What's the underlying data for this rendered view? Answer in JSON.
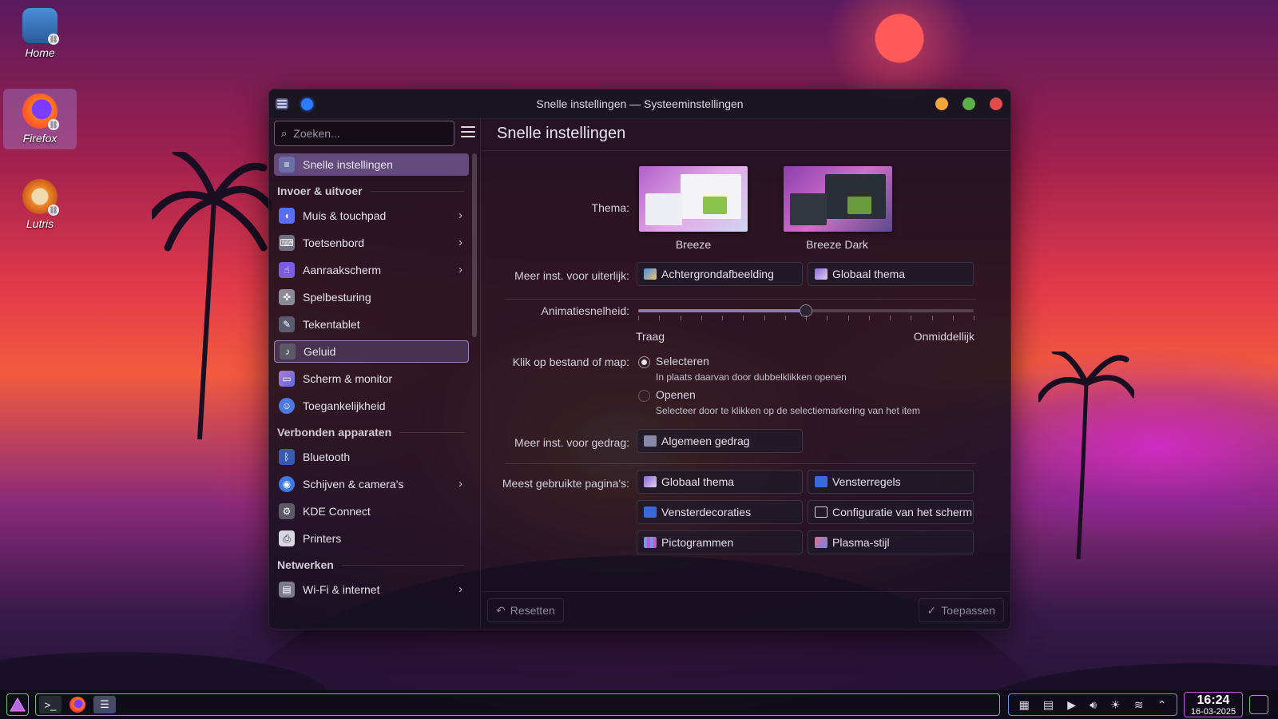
{
  "desktop": {
    "icons": [
      {
        "label": "Home",
        "icon": "folder-icon"
      },
      {
        "label": "Firefox",
        "icon": "firefox-icon"
      },
      {
        "label": "Lutris",
        "icon": "lutris-icon"
      }
    ]
  },
  "window": {
    "title": "Snelle instellingen — Systeeminstellingen"
  },
  "sidebar": {
    "search_placeholder": "Zoeken...",
    "top_item": "Snelle instellingen",
    "sections": [
      {
        "title": "Invoer & uitvoer",
        "items": [
          {
            "label": "Muis & touchpad",
            "icon": "mouse-icon",
            "chevron": true
          },
          {
            "label": "Toetsenbord",
            "icon": "keyboard-icon",
            "chevron": true
          },
          {
            "label": "Aanraakscherm",
            "icon": "touchscreen-icon",
            "chevron": true
          },
          {
            "label": "Spelbesturing",
            "icon": "gamepad-icon",
            "chevron": false
          },
          {
            "label": "Tekentablet",
            "icon": "tablet-icon",
            "chevron": false
          },
          {
            "label": "Geluid",
            "icon": "sound-icon",
            "chevron": false
          },
          {
            "label": "Scherm & monitor",
            "icon": "display-icon",
            "chevron": false
          },
          {
            "label": "Toegankelijkheid",
            "icon": "accessibility-icon",
            "chevron": false
          }
        ]
      },
      {
        "title": "Verbonden apparaten",
        "items": [
          {
            "label": "Bluetooth",
            "icon": "bluetooth-icon",
            "chevron": false
          },
          {
            "label": "Schijven & camera's",
            "icon": "drive-icon",
            "chevron": true
          },
          {
            "label": "KDE Connect",
            "icon": "kdeconnect-icon",
            "chevron": false
          },
          {
            "label": "Printers",
            "icon": "printer-icon",
            "chevron": false
          }
        ]
      },
      {
        "title": "Netwerken",
        "items": [
          {
            "label": "Wi-Fi & internet",
            "icon": "wifi-icon",
            "chevron": true
          }
        ]
      }
    ]
  },
  "content": {
    "title": "Snelle instellingen",
    "theme_label": "Thema:",
    "themes": [
      {
        "name": "Breeze"
      },
      {
        "name": "Breeze Dark"
      }
    ],
    "appearance_label": "Meer inst. voor uiterlijk:",
    "appearance_buttons": [
      "Achtergrondafbeelding",
      "Globaal thema"
    ],
    "animation_label": "Animatiesnelheid:",
    "animation_value": 0.5,
    "animation_min": "Traag",
    "animation_max": "Onmiddellijk",
    "click_label": "Klik op bestand of map:",
    "click_options": [
      {
        "label": "Selecteren",
        "hint": "In plaats daarvan door dubbelklikken openen",
        "selected": true
      },
      {
        "label": "Openen",
        "hint": "Selecteer door te klikken op de selectiemarkering van het item",
        "selected": false
      }
    ],
    "behavior_label": "Meer inst. voor gedrag:",
    "behavior_button": "Algemeen gedrag",
    "most_used_label": "Meest gebruikte pagina's:",
    "most_used": [
      "Globaal thema",
      "Vensterregels",
      "Vensterdecoraties",
      "Configuratie van het scherm",
      "Pictogrammen",
      "Plasma-stijl"
    ],
    "reset_label": "Resetten",
    "apply_label": "Toepassen"
  },
  "taskbar": {
    "time": "16:24",
    "date": "16-03-2025"
  },
  "colors": {
    "accent": "#9a82d0",
    "close": "#e24b4b",
    "minimize": "#f0a63a",
    "maximize": "#5bb04a"
  }
}
